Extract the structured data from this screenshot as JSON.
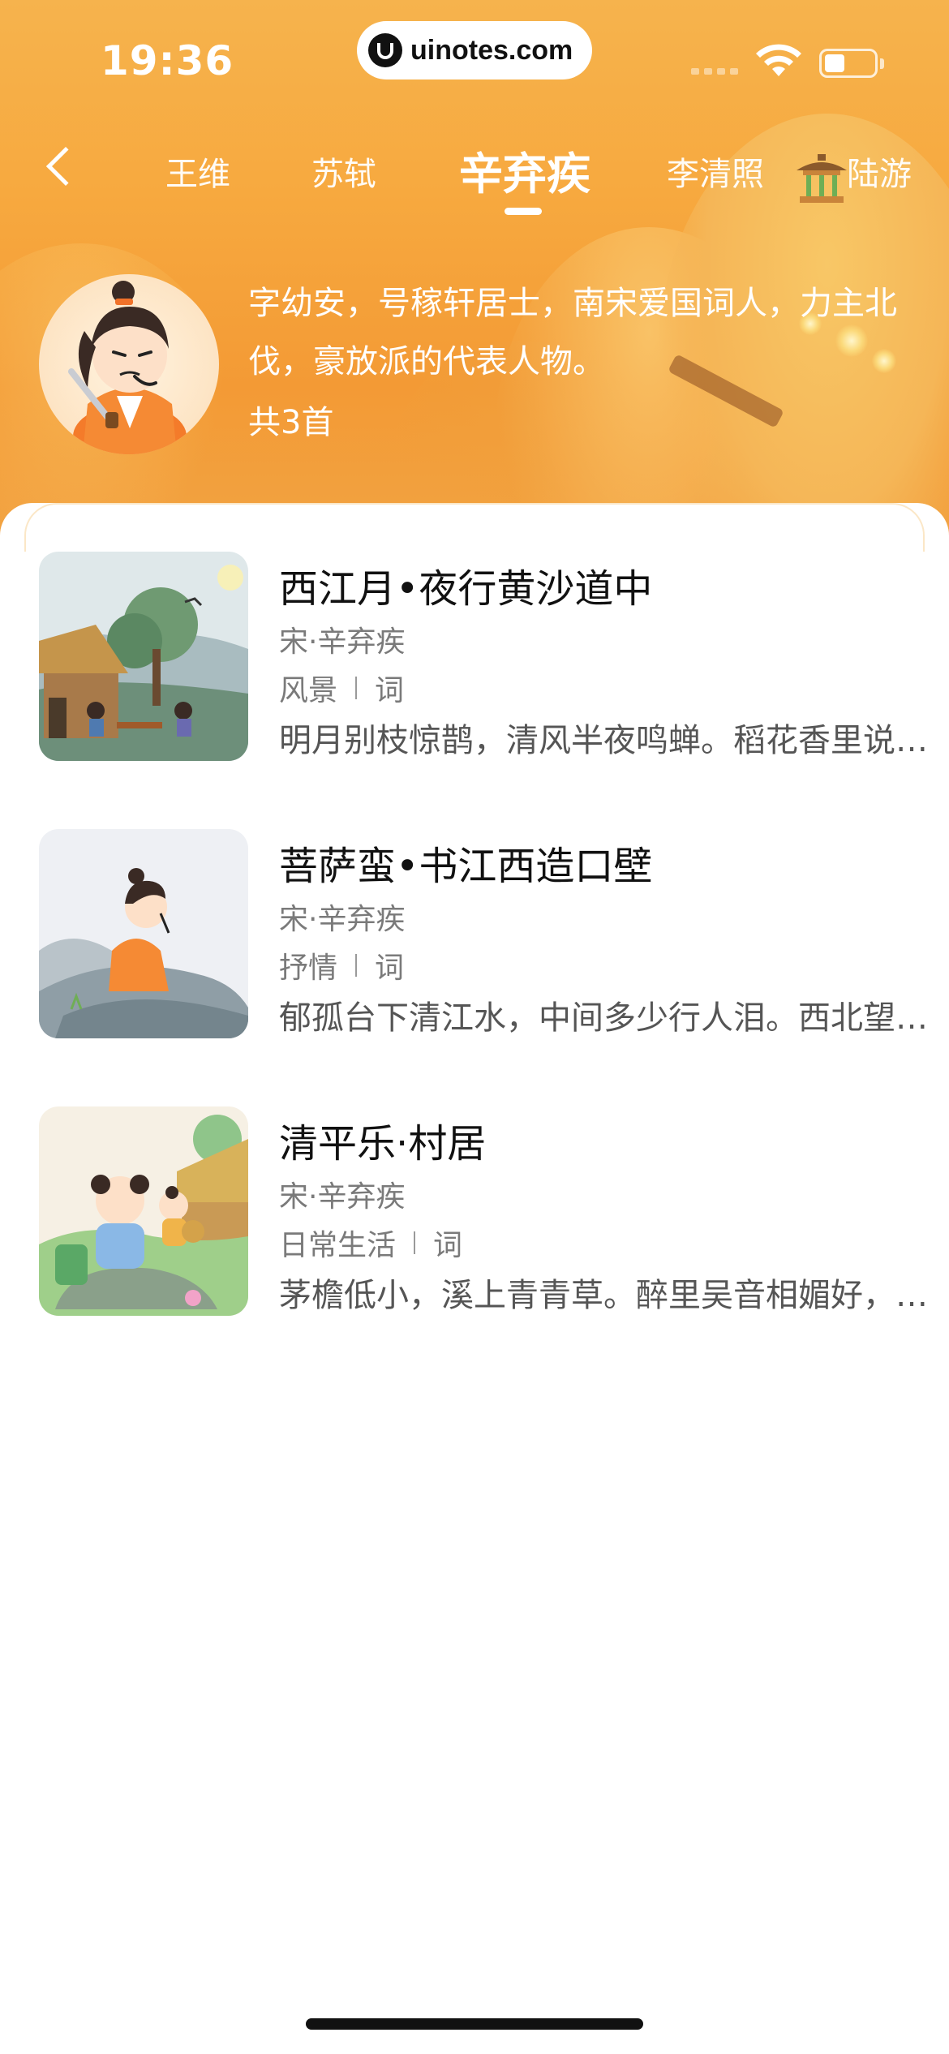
{
  "status_bar": {
    "time": "19:36",
    "url": "uinotes.com",
    "icons": [
      "cellular-signal-icon",
      "wifi-icon",
      "battery-icon"
    ]
  },
  "nav": {
    "back_icon": "chevron-left-icon",
    "tabs": [
      {
        "label": "王维",
        "active": false
      },
      {
        "label": "苏轼",
        "active": false
      },
      {
        "label": "辛弃疾",
        "active": true
      },
      {
        "label": "李清照",
        "active": false
      },
      {
        "label": "陆游",
        "active": false
      }
    ]
  },
  "poet": {
    "bio": "字幼安，号稼轩居士，南宋爱国词人，力主北伐，豪放派的代表人物。",
    "count": "共3首"
  },
  "poems": [
    {
      "title": "西江月•夜行黄沙道中",
      "author": "宋·辛弃疾",
      "tag": "风景",
      "form": "词",
      "excerpt": "明月别枝惊鹊，清风半夜鸣蝉。稻花香里说丰年，听取蛙声一片。"
    },
    {
      "title": "菩萨蛮•书江西造口壁",
      "author": "宋·辛弃疾",
      "tag": "抒情",
      "form": "词",
      "excerpt": "郁孤台下清江水，中间多少行人泪。西北望长安，可怜无数山。"
    },
    {
      "title": "清平乐·村居",
      "author": "宋·辛弃疾",
      "tag": "日常生活",
      "form": "词",
      "excerpt": "茅檐低小，溪上青青草。醉里吴音相媚好，白发谁家翁媪。"
    }
  ],
  "colors": {
    "header_orange": "#f7a93f",
    "text_primary": "#111111",
    "text_secondary": "#7a7a7a"
  }
}
